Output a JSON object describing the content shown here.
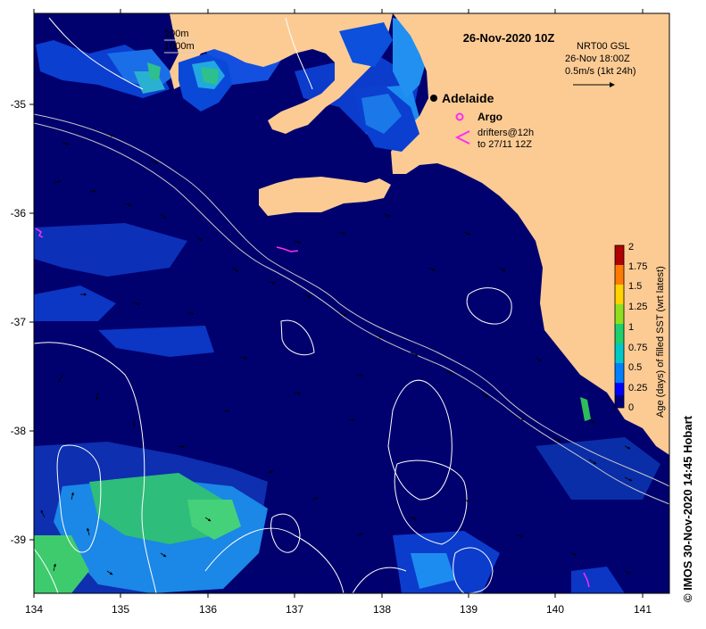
{
  "map": {
    "title": "26-Nov-2020 10Z",
    "product_lines": [
      "NRT00 GSL",
      "26-Nov 18:00Z",
      "0.5m/s (1kt 24h)"
    ],
    "isobath_labels": [
      "200m",
      "1000m"
    ],
    "city": "Adelaide",
    "argo_label": "Argo",
    "drifter_lines": [
      "drifters@12h",
      "to 27/11 12Z"
    ],
    "x_ticks": [
      "134",
      "135",
      "136",
      "137",
      "138",
      "139",
      "140",
      "141"
    ],
    "y_ticks": [
      "-35",
      "-36",
      "-37",
      "-38",
      "-39"
    ],
    "colorbar": {
      "ticks": [
        "2",
        "1.75",
        "1.5",
        "1.25",
        "1",
        "0.75",
        "0.5",
        "0.25",
        "0"
      ],
      "label": "Age (days) of filled SST (wrt latest)",
      "colors": [
        "#00007f",
        "#0000ff",
        "#007fff",
        "#00c8c8",
        "#1ecf6e",
        "#8fdf20",
        "#ffd200",
        "#ff7a00",
        "#b00000"
      ]
    },
    "copyright": "© IMOS 30-Nov-2020 14:45 Hobart",
    "land_color": "#fccb94",
    "ocean_color": "#00006e"
  }
}
